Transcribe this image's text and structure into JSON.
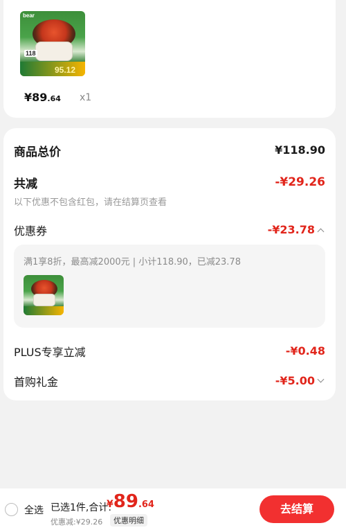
{
  "product": {
    "brand": "bear",
    "promo_price": "95.12",
    "tag_price": "118",
    "price_main": "¥89",
    "price_decimal": ".64",
    "quantity": "x1"
  },
  "summary": {
    "total_label": "商品总价",
    "total_value": "¥118.90",
    "reduce_label": "共减",
    "reduce_value": "-¥29.26",
    "hint": "以下优惠不包含红包，请在结算页查看",
    "coupon_label": "优惠券",
    "coupon_value": "-¥23.78",
    "coupon_detail": "满1享8折，最高减2000元 | 小计118.90，已减23.78",
    "plus_label": "PLUS专享立减",
    "plus_value": "-¥0.48",
    "first_label": "首购礼金",
    "first_value": "-¥5.00"
  },
  "bottom": {
    "select_all": "全选",
    "selected_text": "已选1件,合计:",
    "currency": "¥",
    "total_int": "89",
    "total_dec": ".64",
    "discount_text": "优惠减:¥29.26",
    "detail_button": "优惠明细",
    "checkout": "去结算"
  },
  "colors": {
    "accent": "#e1251b",
    "checkout_bg": "#f23030",
    "page_bg": "#f2f2f2"
  }
}
